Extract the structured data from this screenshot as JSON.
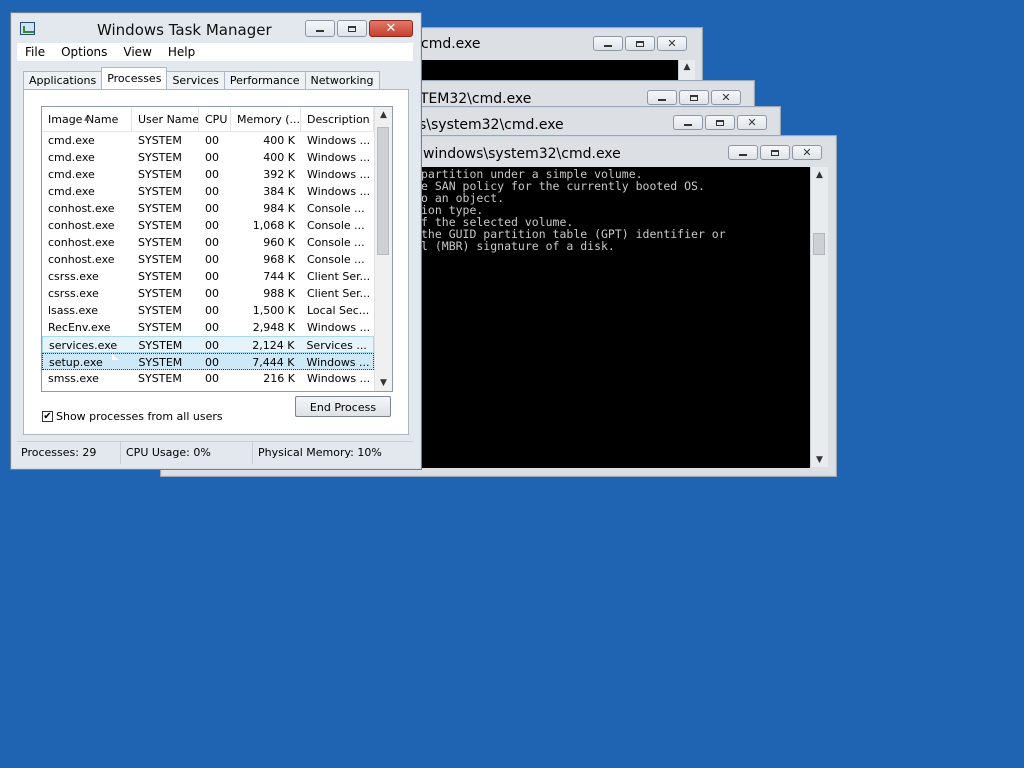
{
  "console_windows": [
    {
      "title": "cmd.exe"
    },
    {
      "title": "STEM32\\cmd.exe"
    },
    {
      "title": "s\\system32\\cmd.exe"
    },
    {
      "title": "windows\\system32\\cmd.exe"
    }
  ],
  "console_text": [
    "partition under a simple volume.",
    "e SAN policy for the currently booted OS.",
    "o an object.",
    "ion type.",
    "f the selected volume.",
    "the GUID partition table (GPT) identifier or",
    "l (MBR) signature of a disk."
  ],
  "taskmgr": {
    "title": "Windows Task Manager",
    "menu": [
      "File",
      "Options",
      "View",
      "Help"
    ],
    "tabs": [
      "Applications",
      "Processes",
      "Services",
      "Performance",
      "Networking"
    ],
    "active_tab": "Processes",
    "columns": [
      "Image Name",
      "User Name",
      "CPU",
      "Memory (...",
      "Description"
    ],
    "processes": [
      {
        "name": "cmd.exe",
        "user": "SYSTEM",
        "cpu": "00",
        "mem": "400 K",
        "desc": "Windows ..."
      },
      {
        "name": "cmd.exe",
        "user": "SYSTEM",
        "cpu": "00",
        "mem": "400 K",
        "desc": "Windows ..."
      },
      {
        "name": "cmd.exe",
        "user": "SYSTEM",
        "cpu": "00",
        "mem": "392 K",
        "desc": "Windows ..."
      },
      {
        "name": "cmd.exe",
        "user": "SYSTEM",
        "cpu": "00",
        "mem": "384 K",
        "desc": "Windows ..."
      },
      {
        "name": "conhost.exe",
        "user": "SYSTEM",
        "cpu": "00",
        "mem": "984 K",
        "desc": "Console ..."
      },
      {
        "name": "conhost.exe",
        "user": "SYSTEM",
        "cpu": "00",
        "mem": "1,068 K",
        "desc": "Console ..."
      },
      {
        "name": "conhost.exe",
        "user": "SYSTEM",
        "cpu": "00",
        "mem": "960 K",
        "desc": "Console ..."
      },
      {
        "name": "conhost.exe",
        "user": "SYSTEM",
        "cpu": "00",
        "mem": "968 K",
        "desc": "Console ..."
      },
      {
        "name": "csrss.exe",
        "user": "SYSTEM",
        "cpu": "00",
        "mem": "744 K",
        "desc": "Client Ser..."
      },
      {
        "name": "csrss.exe",
        "user": "SYSTEM",
        "cpu": "00",
        "mem": "988 K",
        "desc": "Client Ser..."
      },
      {
        "name": "lsass.exe",
        "user": "SYSTEM",
        "cpu": "00",
        "mem": "1,500 K",
        "desc": "Local Sec..."
      },
      {
        "name": "RecEnv.exe",
        "user": "SYSTEM",
        "cpu": "00",
        "mem": "2,948 K",
        "desc": "Windows ..."
      },
      {
        "name": "services.exe",
        "user": "SYSTEM",
        "cpu": "00",
        "mem": "2,124 K",
        "desc": "Services ..."
      },
      {
        "name": "setup.exe",
        "user": "SYSTEM",
        "cpu": "00",
        "mem": "7,444 K",
        "desc": "Windows ..."
      },
      {
        "name": "smss.exe",
        "user": "SYSTEM",
        "cpu": "00",
        "mem": "216 K",
        "desc": "Windows ..."
      }
    ],
    "hover_row": 12,
    "selected_row": 13,
    "show_all_users_label": "Show processes from all users",
    "show_all_users_checked": true,
    "end_process_label": "End Process",
    "status": {
      "processes": "Processes: 29",
      "cpu": "CPU Usage: 0%",
      "memory": "Physical Memory: 10%"
    }
  }
}
